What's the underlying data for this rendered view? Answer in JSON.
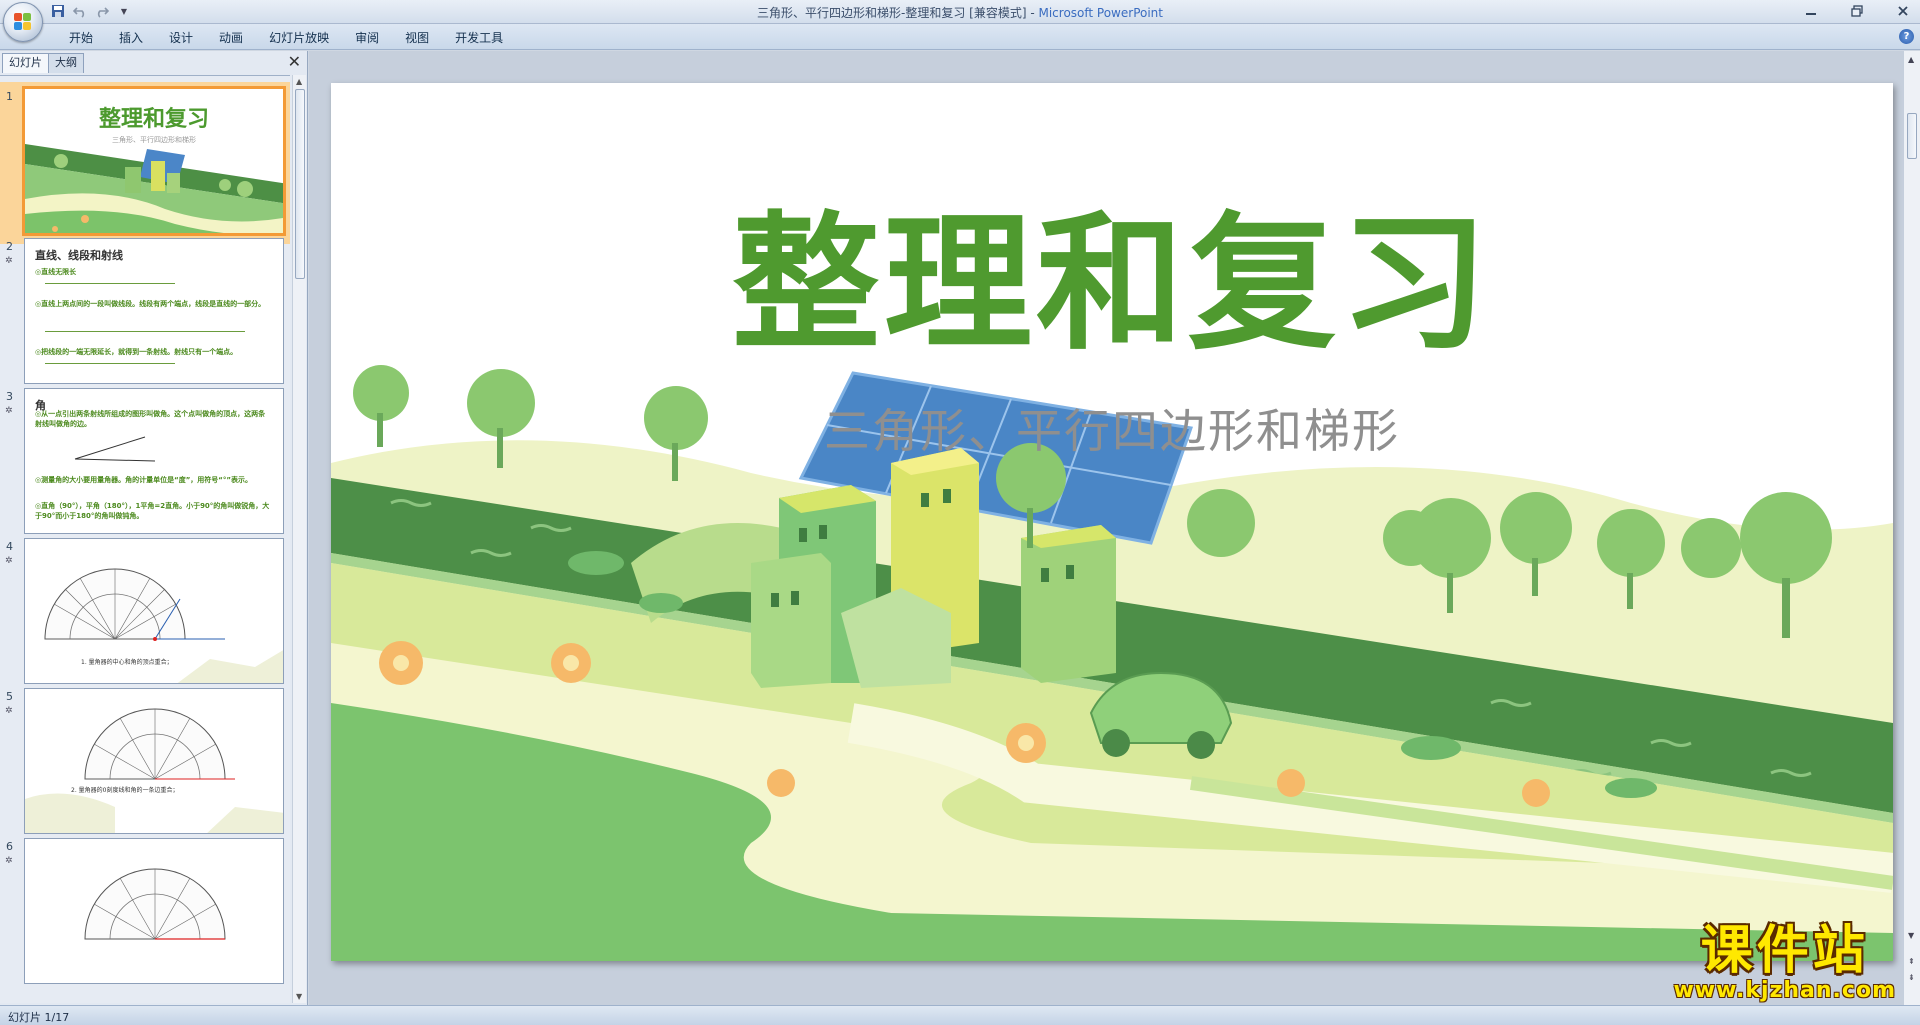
{
  "window": {
    "doc_title": "三角形、平行四边形和梯形-整理和复习 [兼容模式]",
    "separator": " - ",
    "app_name": "Microsoft PowerPoint"
  },
  "quick_access": [
    "save-icon",
    "undo-icon",
    "redo-icon",
    "customize-icon"
  ],
  "ribbon": {
    "tabs": [
      "开始",
      "插入",
      "设计",
      "动画",
      "幻灯片放映",
      "审阅",
      "视图",
      "开发工具"
    ]
  },
  "left_pane": {
    "tabs": [
      "幻灯片",
      "大纲"
    ],
    "close_glyph": "✕",
    "slides": [
      {
        "num": "1",
        "title": "整理和复习",
        "subtitle": "三角形、平行四边形和梯形"
      },
      {
        "num": "2",
        "heading": "直线、线段和射线",
        "lines": [
          "◎直线无限长",
          "◎直线上两点间的一段叫做线段。线段有两个端点，线段是直线的一部分。",
          "◎把线段的一端无限延长，就得到一条射线。射线只有一个端点。"
        ]
      },
      {
        "num": "3",
        "heading": "角",
        "lines": [
          "◎从一点引出两条射线所组成的图形叫做角。这个点叫做角的顶点，这两条射线叫做角的边。",
          "◎测量角的大小要用量角器。角的计量单位是“度”，用符号“°”表示。",
          "◎直角（90°），平角（180°），1平角=2直角。小于90°的角叫做锐角，大于90°而小于180°的角叫做钝角。"
        ]
      },
      {
        "num": "4",
        "caption": "1. 量角器的中心和角的顶点重合；"
      },
      {
        "num": "5",
        "caption": "2. 量角器的0刻度线和角的一条边重合；"
      },
      {
        "num": "6",
        "caption": ""
      }
    ]
  },
  "slide": {
    "title": "整理和复习",
    "subtitle": "三角形、平行四边形和梯形"
  },
  "status": {
    "text": "幻灯片 1/17"
  },
  "watermark": {
    "big": "课件站",
    "small": "www.kjzhan.com"
  },
  "colors": {
    "title_green": "#4f9a2f",
    "selection_orange": "#f39a36",
    "watermark_yellow": "#ffe800"
  }
}
